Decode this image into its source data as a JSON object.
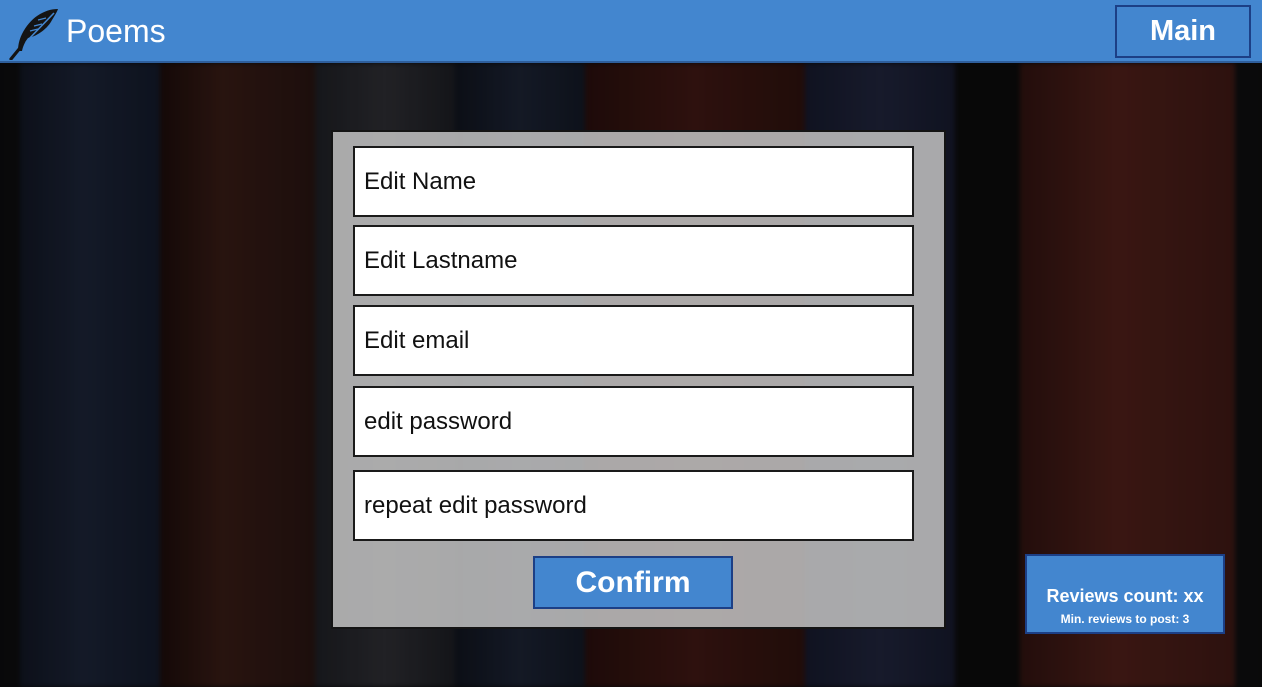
{
  "header": {
    "title": "Poems",
    "logo_icon": "feather-quill-icon",
    "main_button_label": "Main"
  },
  "form": {
    "fields": [
      {
        "id": "name",
        "text": "Edit Name"
      },
      {
        "id": "lastname",
        "text": "Edit Lastname"
      },
      {
        "id": "email",
        "text": "Edit email"
      },
      {
        "id": "password",
        "text": "edit password"
      },
      {
        "id": "repeat_password",
        "text": "repeat edit password"
      }
    ],
    "confirm_label": "Confirm"
  },
  "reviews": {
    "count_label": "Reviews count: xx",
    "min_label": "Min. reviews to post: 3"
  },
  "colors": {
    "accent": "#4386cf",
    "accent_border": "#1c3f86",
    "panel": "#bebebe",
    "field_bg": "#ffffff"
  }
}
